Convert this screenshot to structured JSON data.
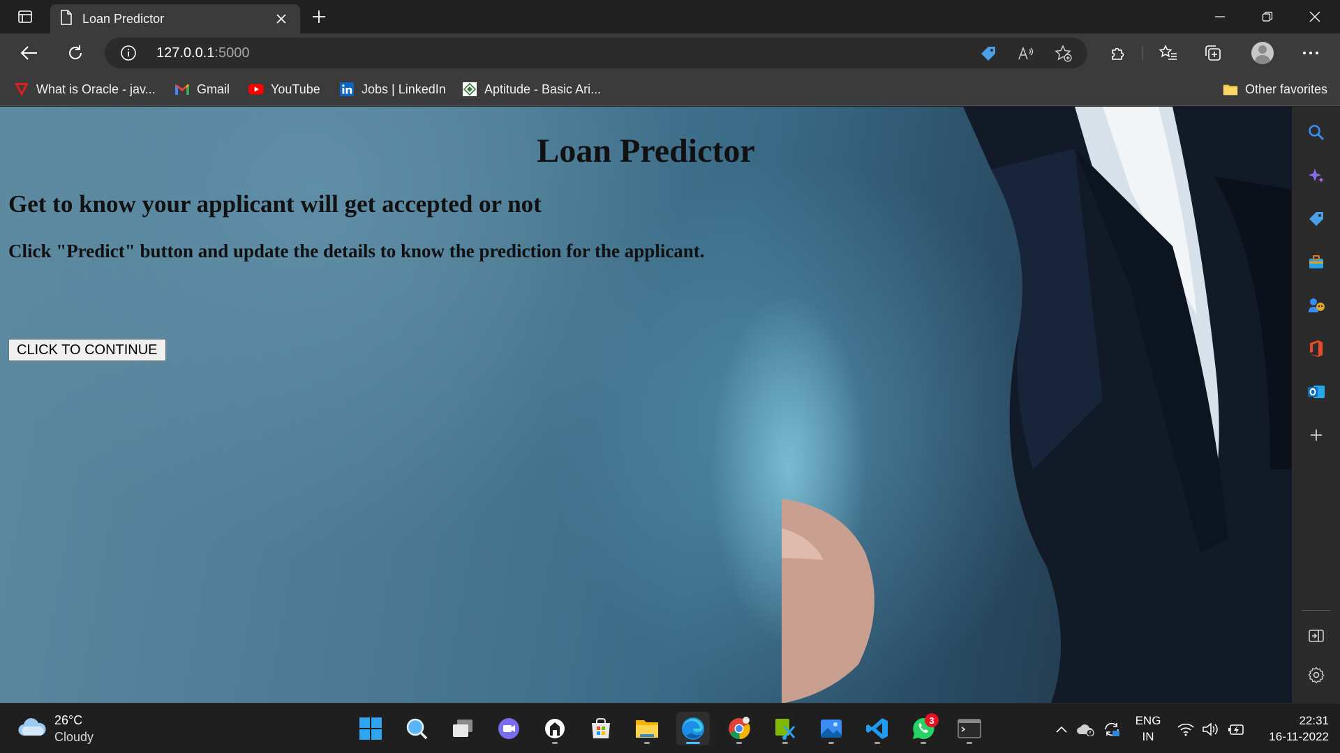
{
  "browser": {
    "tab_title": "Loan Predictor",
    "url_host": "127.0.0.1",
    "url_port": ":5000"
  },
  "favorites": {
    "items": [
      {
        "label": "What is Oracle - jav...",
        "icon": "oracle-icon"
      },
      {
        "label": "Gmail",
        "icon": "gmail-icon"
      },
      {
        "label": "YouTube",
        "icon": "youtube-icon"
      },
      {
        "label": "Jobs | LinkedIn",
        "icon": "linkedin-icon"
      },
      {
        "label": "Aptitude - Basic Ari...",
        "icon": "aptitude-icon"
      }
    ],
    "other": "Other favorites"
  },
  "page": {
    "title": "Loan Predictor",
    "subtitle": "Get to know your applicant will get accepted or not",
    "instruction": "Click \"Predict\" button and update the details to know the prediction for the applicant.",
    "button": "CLICK TO CONTINUE"
  },
  "taskbar": {
    "weather_temp": "26°C",
    "weather_cond": "Cloudy",
    "lang_line1": "ENG",
    "lang_line2": "IN",
    "time": "22:31",
    "date": "16-11-2022",
    "whatsapp_badge": "3"
  },
  "colors": {
    "accent": "#4cc2ff",
    "tab_bg": "#3b3b3b",
    "frame_bg": "#202020"
  }
}
